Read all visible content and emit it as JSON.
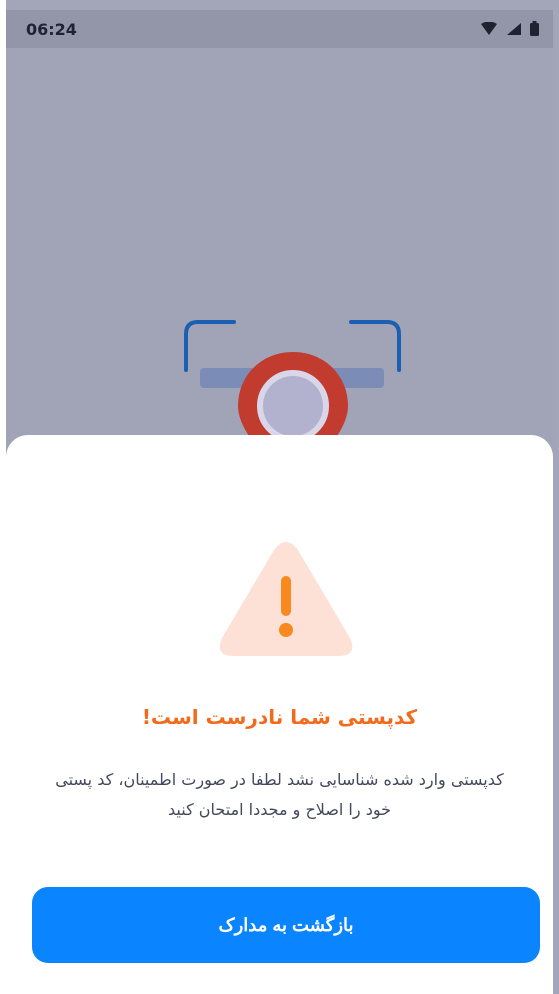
{
  "status_bar": {
    "time": "06:24"
  },
  "dialog": {
    "title": "کدپستی شما نادرست است!",
    "message": "کدپستی وارد شده شناسایی نشد لطفا در صورت اطمینان، کد پستی خود را اصلاح و مجددا امتحان کنید",
    "button_label": "بازگشت به مدارک"
  },
  "icons": {
    "status": [
      "wifi-icon",
      "signal-icon",
      "battery-icon"
    ],
    "illustration": "location-scan-icon",
    "warning": "warning-icon"
  },
  "colors": {
    "accent": "#0a84ff",
    "warning": "#f26b1d",
    "pin": "#d83b2c"
  }
}
